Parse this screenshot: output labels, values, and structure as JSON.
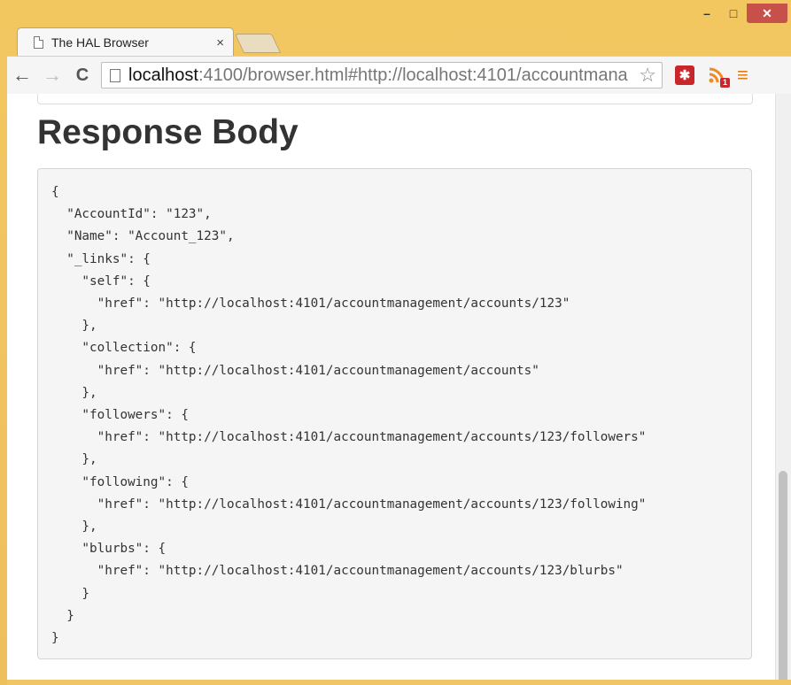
{
  "window": {
    "controls": {
      "minimize": "–",
      "maximize": "□",
      "close": "✕"
    }
  },
  "tab": {
    "title": "The HAL Browser",
    "close": "×"
  },
  "toolbar": {
    "back": "←",
    "forward": "→",
    "reload": "C",
    "url_host": "localhost",
    "url_rest": ":4100/browser.html#http://localhost:4101/accountmana",
    "bookmark_star": "☆",
    "extension_badge": "1",
    "menu": "≡"
  },
  "content": {
    "heading": "Response Body",
    "response_body": "{\n  \"AccountId\": \"123\",\n  \"Name\": \"Account_123\",\n  \"_links\": {\n    \"self\": {\n      \"href\": \"http://localhost:4101/accountmanagement/accounts/123\"\n    },\n    \"collection\": {\n      \"href\": \"http://localhost:4101/accountmanagement/accounts\"\n    },\n    \"followers\": {\n      \"href\": \"http://localhost:4101/accountmanagement/accounts/123/followers\"\n    },\n    \"following\": {\n      \"href\": \"http://localhost:4101/accountmanagement/accounts/123/following\"\n    },\n    \"blurbs\": {\n      \"href\": \"http://localhost:4101/accountmanagement/accounts/123/blurbs\"\n    }\n  }\n}"
  },
  "colors": {
    "window_frame": "#f0c566",
    "close_button": "#c7504a",
    "extension_red": "#c9262c",
    "rss_orange": "#f08a24",
    "code_background": "#f5f5f5"
  }
}
